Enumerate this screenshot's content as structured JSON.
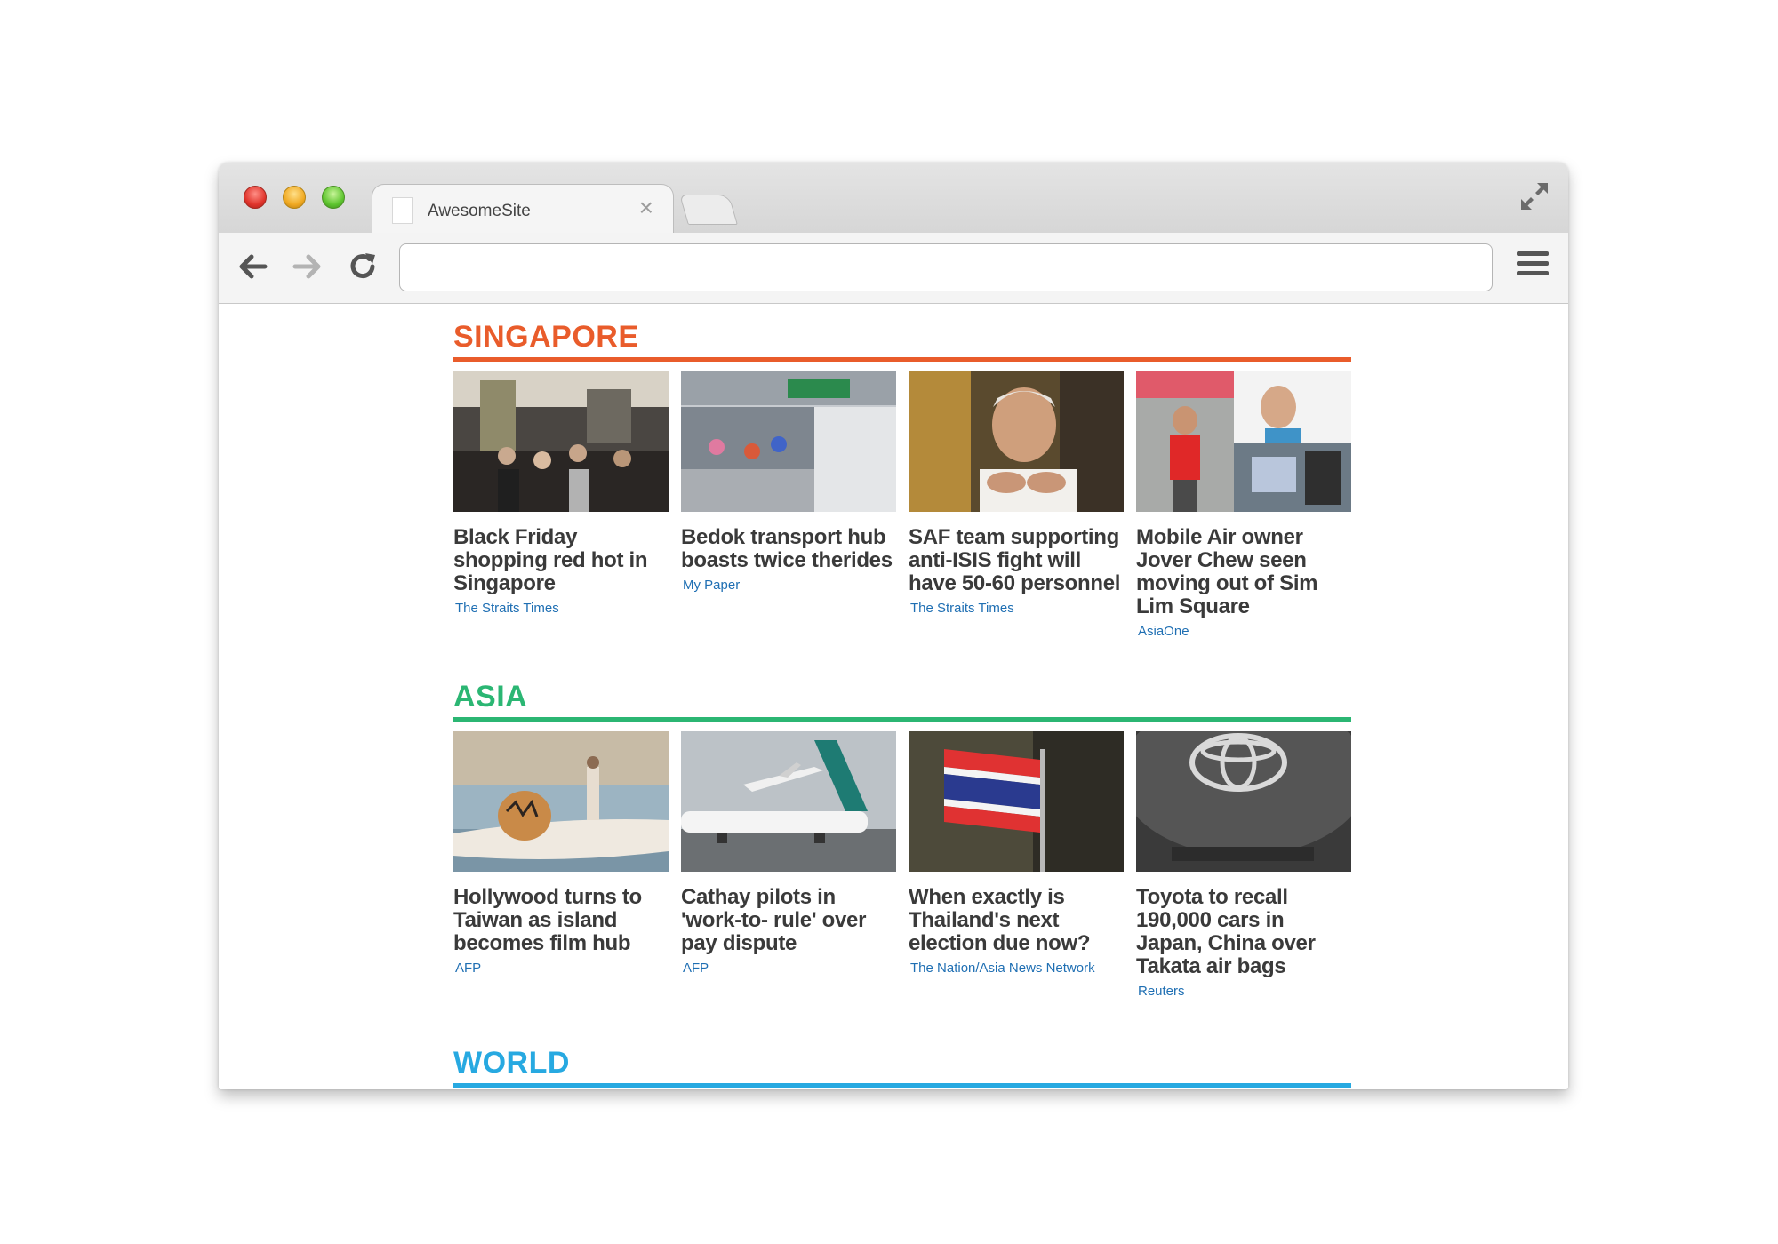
{
  "browser": {
    "tab_title": "AwesomeSite",
    "tab_close_glyph": "×",
    "address": "",
    "icons": [
      "back-icon",
      "forward-icon",
      "reload-icon",
      "menu-icon",
      "fullscreen-icon",
      "close-icon"
    ]
  },
  "colors": {
    "singapore": "#e95c2b",
    "asia": "#2bb673",
    "world": "#27a9e1",
    "source_link": "#1f6fb3"
  },
  "sections": [
    {
      "title": "SINGAPORE",
      "cards": [
        {
          "headline": "Black Friday shopping red hot in Singapore",
          "source": "The Straits Times"
        },
        {
          "headline": "Bedok transport hub boasts twice therides",
          "source": "My Paper"
        },
        {
          "headline": "SAF team supporting anti-ISIS fight will have 50-60 personnel",
          "source": "The Straits Times"
        },
        {
          "headline": "Mobile Air owner Jover Chew seen moving out of Sim Lim Square",
          "source": "AsiaOne"
        }
      ]
    },
    {
      "title": "ASIA",
      "cards": [
        {
          "headline": "Hollywood turns to Taiwan as island becomes film hub",
          "source": "AFP"
        },
        {
          "headline": "Cathay pilots in 'work-to- rule' over pay dispute",
          "source": "AFP"
        },
        {
          "headline": "When exactly is Thailand's next election due now?",
          "source": "The Nation/Asia News Network"
        },
        {
          "headline": "Toyota to recall 190,000 cars in Japan, China over Takata air bags",
          "source": "Reuters"
        }
      ]
    },
    {
      "title": "WORLD"
    }
  ]
}
